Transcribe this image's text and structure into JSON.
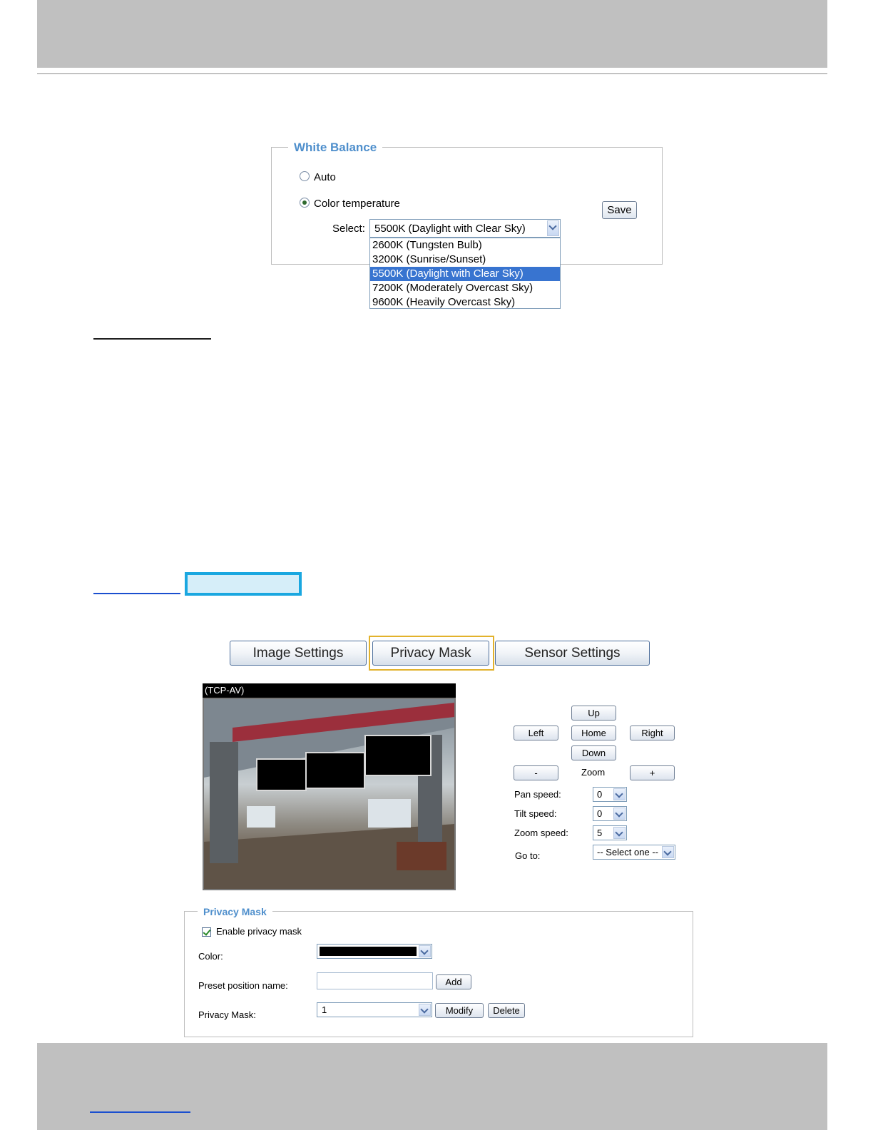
{
  "white_balance": {
    "legend": "White Balance",
    "auto_label": "Auto",
    "color_temp_label": "Color temperature",
    "select_label": "Select:",
    "selected_value": "5500K (Daylight with Clear Sky)",
    "save_label": "Save",
    "options": [
      "2600K (Tungsten Bulb)",
      "3200K (Sunrise/Sunset)",
      "5500K (Daylight with Clear Sky)",
      "7200K (Moderately Overcast Sky)",
      "9600K (Heavily Overcast Sky)"
    ],
    "selected_index": 2
  },
  "tabs": [
    "Image Settings",
    "Privacy Mask",
    "Sensor Settings"
  ],
  "video": {
    "title": "(TCP-AV)"
  },
  "ptz": {
    "up": "Up",
    "left": "Left",
    "home": "Home",
    "right": "Right",
    "down": "Down",
    "zoom_out": "-",
    "zoom_label": "Zoom",
    "zoom_in": "+",
    "pan_speed_label": "Pan speed:",
    "pan_speed_value": "0",
    "tilt_speed_label": "Tilt speed:",
    "tilt_speed_value": "0",
    "zoom_speed_label": "Zoom speed:",
    "zoom_speed_value": "5",
    "goto_label": "Go to:",
    "goto_value": "-- Select one --"
  },
  "privacy_mask": {
    "legend": "Privacy Mask",
    "enable_label": "Enable privacy mask",
    "color_label": "Color:",
    "color_value": "#000000",
    "preset_label": "Preset position name:",
    "preset_value": "",
    "add_label": "Add",
    "mask_label": "Privacy Mask:",
    "mask_value": "1",
    "modify_label": "Modify",
    "delete_label": "Delete"
  },
  "colors": {
    "header_gray": "#c0c0c0",
    "legend_blue": "#4f8fcc",
    "selection_blue": "#3874d0",
    "tab_highlight": "#e2b22c",
    "callout_blue": "#1aa7e0"
  }
}
